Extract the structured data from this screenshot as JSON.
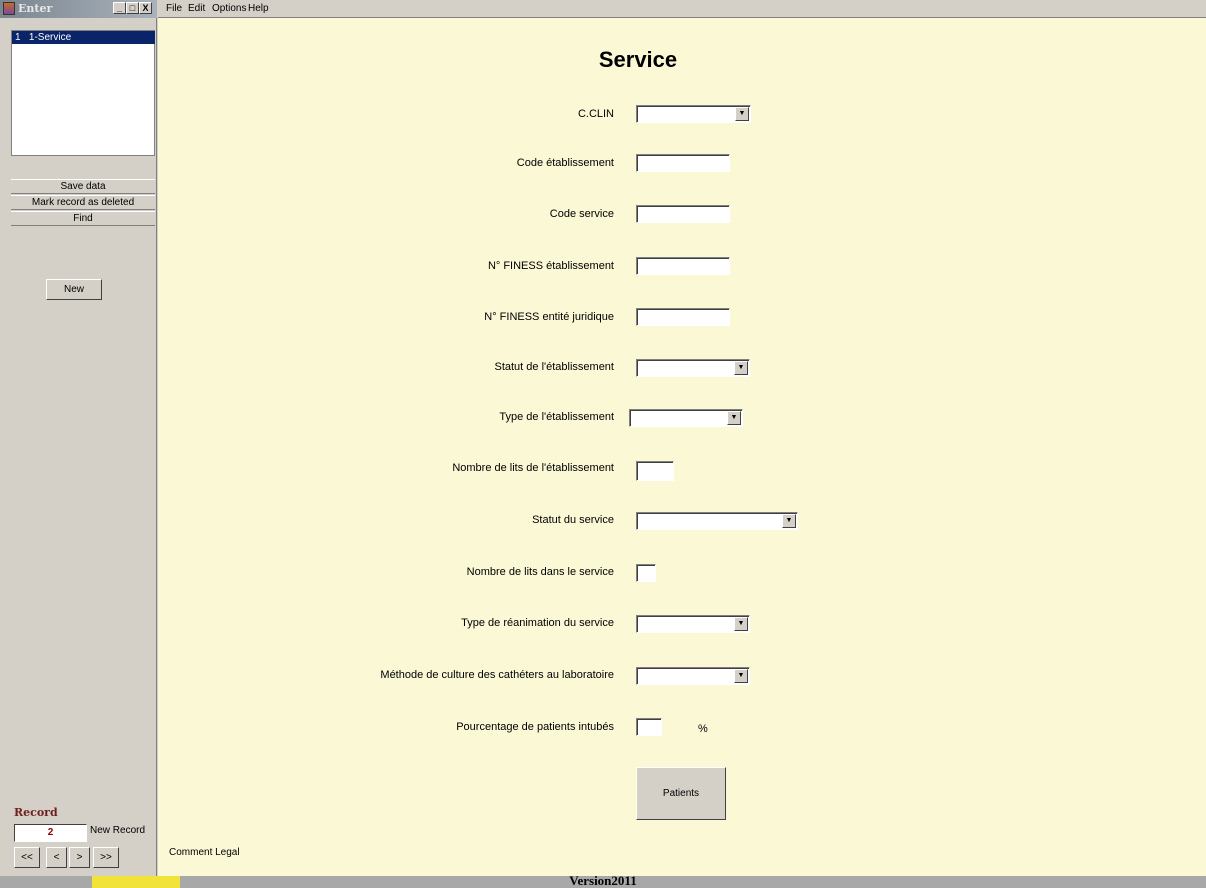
{
  "window": {
    "title": "Enter",
    "minimize": "_",
    "maximize": "□",
    "close": "X"
  },
  "list": {
    "items": [
      "1   1-Service"
    ]
  },
  "commands": {
    "save": "Save data",
    "mark_deleted": "Mark record as deleted",
    "find": "Find"
  },
  "new_button": "New",
  "record": {
    "label": "Record",
    "number": "2",
    "status": "New Record"
  },
  "nav": {
    "first": "<<",
    "prev": "<",
    "next": ">",
    "last": ">>"
  },
  "menu": [
    "File",
    "Edit",
    "Options",
    "Help"
  ],
  "form": {
    "title": "Service",
    "fields": [
      {
        "label": "C.CLIN",
        "type": "combo",
        "value": ""
      },
      {
        "label": "Code établissement",
        "type": "text",
        "value": ""
      },
      {
        "label": "Code service",
        "type": "text",
        "value": ""
      },
      {
        "label": "N° FINESS établissement",
        "type": "text",
        "value": ""
      },
      {
        "label": "N° FINESS entité juridique",
        "type": "text",
        "value": ""
      },
      {
        "label": "Statut de l'établissement",
        "type": "combo",
        "value": ""
      },
      {
        "label": "Type de l'établissement",
        "type": "combo",
        "value": ""
      },
      {
        "label": "Nombre de lits de l'établissement",
        "type": "text",
        "value": ""
      },
      {
        "label": "Statut du service",
        "type": "combo",
        "value": ""
      },
      {
        "label": "Nombre de lits dans le service",
        "type": "text",
        "value": ""
      },
      {
        "label": "Type de réanimation du service",
        "type": "combo",
        "value": ""
      },
      {
        "label": "Méthode de culture des cathéters au laboratoire",
        "type": "combo",
        "value": ""
      },
      {
        "label": "Pourcentage de patients intubés",
        "type": "text",
        "value": ""
      }
    ],
    "percent_sign": "%",
    "patients_button": "Patients",
    "comment": "Comment Legal"
  },
  "status": {
    "version": "Version2011"
  },
  "colors": {
    "form_bg": "#fbf8d6",
    "panel_bg": "#d4d0c8",
    "selection": "#0a246a",
    "status_yellow": "#f2e33a"
  }
}
